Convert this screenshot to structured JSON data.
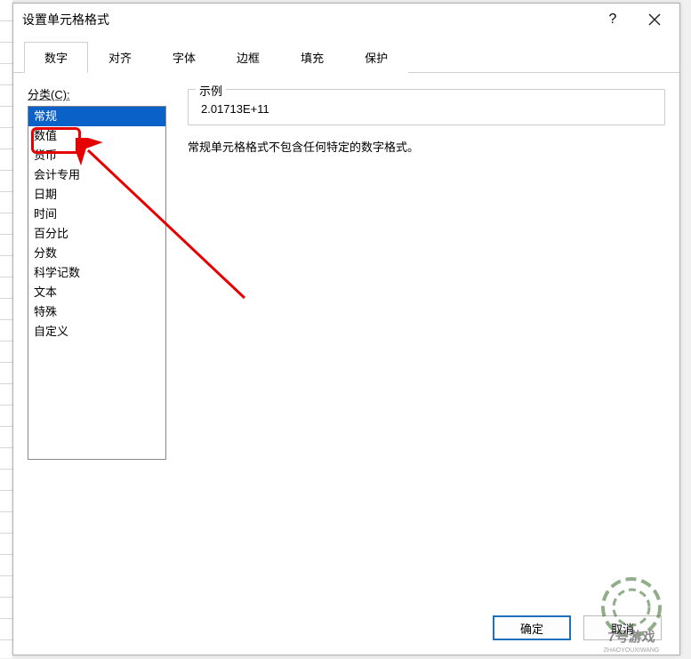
{
  "titlebar": {
    "title": "设置单元格格式",
    "help": "?"
  },
  "tabs": {
    "items": [
      {
        "label": "数字",
        "active": true
      },
      {
        "label": "对齐",
        "active": false
      },
      {
        "label": "字体",
        "active": false
      },
      {
        "label": "边框",
        "active": false
      },
      {
        "label": "填充",
        "active": false
      },
      {
        "label": "保护",
        "active": false
      }
    ]
  },
  "category": {
    "label": "分类(C):",
    "items": [
      {
        "label": "常规",
        "selected": true
      },
      {
        "label": "数值",
        "selected": false
      },
      {
        "label": "货币",
        "selected": false
      },
      {
        "label": "会计专用",
        "selected": false
      },
      {
        "label": "日期",
        "selected": false
      },
      {
        "label": "时间",
        "selected": false
      },
      {
        "label": "百分比",
        "selected": false
      },
      {
        "label": "分数",
        "selected": false
      },
      {
        "label": "科学记数",
        "selected": false
      },
      {
        "label": "文本",
        "selected": false
      },
      {
        "label": "特殊",
        "selected": false
      },
      {
        "label": "自定义",
        "selected": false
      }
    ]
  },
  "sample": {
    "label": "示例",
    "value": "2.01713E+11"
  },
  "description": "常规单元格格式不包含任何特定的数字格式。",
  "footer": {
    "ok": "确定",
    "cancel": "取消"
  },
  "watermark": {
    "line1": "7号游戏",
    "line2": "ZHAOYOUXIWANG"
  }
}
